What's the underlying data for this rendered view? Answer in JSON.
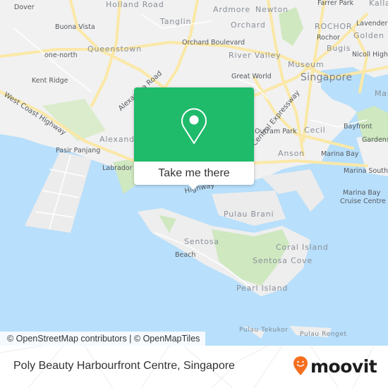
{
  "map": {
    "labels": {
      "dover": "Dover",
      "holland_road": "Holland Road",
      "ardmore": "Ardmore",
      "newton": "Newton",
      "farrer_park": "Farrer Park",
      "kallang": "Kallang",
      "buona_vista": "Buona Vista",
      "tanglin": "Tanglin",
      "orchard": "Orchard",
      "rochor_district": "ROCHOR",
      "rochor": "Rochor",
      "lavender": "Lavender",
      "golden_mile": "Golden Mile",
      "orchard_boulevard": "Orchard Boulevard",
      "queenstown": "Queenstown",
      "bugis": "Bugis",
      "one_north": "one-north",
      "river_valley": "River Valley",
      "nicoll_highway": "Nicoll Highway",
      "museum": "Museum",
      "kent_ridge": "Kent Ridge",
      "alexandra_road": "Alexandra Road",
      "great_world": "Great World",
      "singapore": "Singapore",
      "marina": "Marina",
      "west_coast_highway": "West Coast Highway",
      "expressway": "Central Expressway",
      "outram_park": "Outram Park",
      "cecil": "Cecil",
      "bayfront": "Bayfront",
      "gardens": "Gardens",
      "alexandra": "Alexandra",
      "pasir_panjang": "Pasir Panjang",
      "anson": "Anson",
      "marina_bay": "Marina Bay",
      "labrador_park": "Labrador Park",
      "marina_south_pier": "Marina South Pier",
      "highway": "Highway",
      "pulau_brani": "Pulau Brani",
      "marina_bay_cruise_centre_1": "Marina Bay",
      "marina_bay_cruise_centre_2": "Cruise Centre",
      "sentosa": "Sentosa",
      "coral_island": "Coral Island",
      "beach": "Beach",
      "sentosa_cove": "Sentosa Cove",
      "pearl_island": "Pearl Island",
      "pulau_tekukor": "Pulau Tekukor",
      "pulau_renget": "Pulau Renget"
    },
    "attribution": "© OpenStreetMap contributors | © OpenMapTiles",
    "colors": {
      "water": "#b8dffb",
      "land": "#f1f1f1",
      "road": "#fbe8a6",
      "park": "#cfe8c0"
    }
  },
  "popup": {
    "icon": "map-pin-icon",
    "cta_label": "Take me there",
    "accent": "#1fba6a"
  },
  "footer": {
    "place_name": "Poly Beauty Harbourfront Centre, Singapore",
    "logo_text": "moovit",
    "logo_icon": "moovit-smiley-pin-icon",
    "logo_color": "#f46f1f"
  }
}
